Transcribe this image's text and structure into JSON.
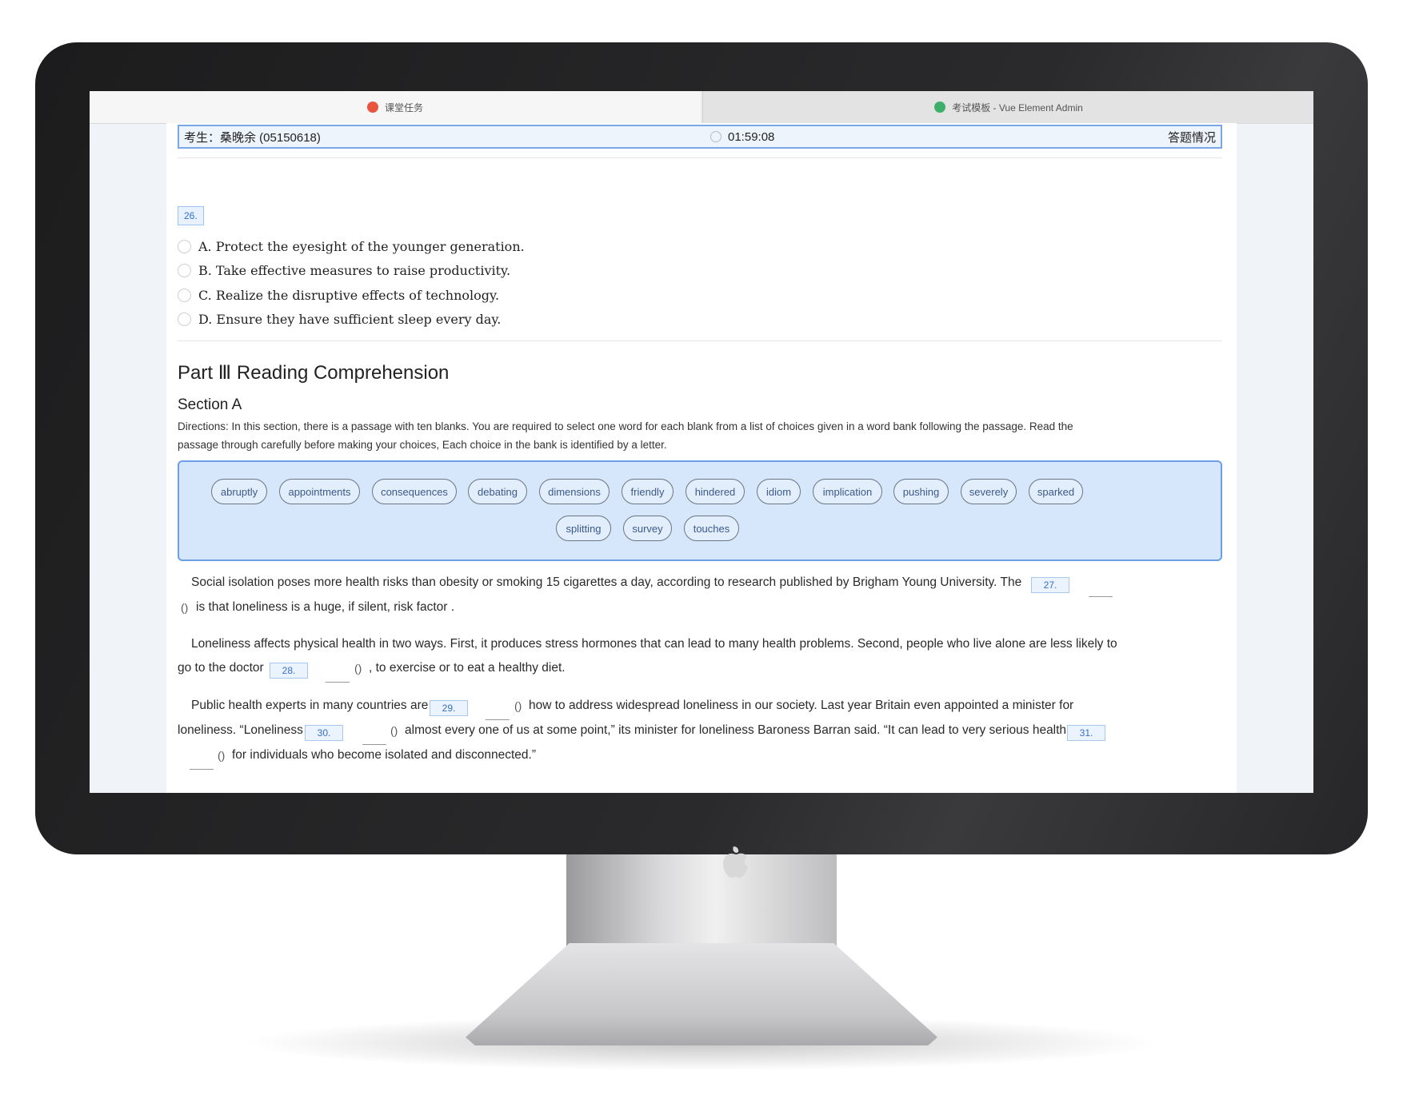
{
  "browser": {
    "tabs": [
      {
        "label": "课堂任务",
        "active": true
      },
      {
        "label": "考试模板 - Vue Element Admin",
        "active": false
      }
    ]
  },
  "exam_header": {
    "student": "考生：桑晚余 (05150618)",
    "timer": "01:59:08",
    "status_link": "答题情况"
  },
  "question26": {
    "number": "26.",
    "options": [
      "A. Protect the eyesight of the younger generation.",
      "B. Take effective measures to raise productivity.",
      "C. Realize the disruptive effects of technology.",
      "D. Ensure they have sufficient sleep every day."
    ]
  },
  "part": {
    "title": "Part Ⅲ Reading Comprehension",
    "section": "Section A",
    "directions_line1": "Directions: In this section, there is a passage with ten blanks. You are required to select one word for each blank from a list of choices given in a word bank following the passage. Read the",
    "directions_line2": "passage through carefully before making your choices, Each choice in the bank is identified by a letter."
  },
  "word_bank": [
    "abruptly",
    "appointments",
    "consequences",
    "debating",
    "dimensions",
    "friendly",
    "hindered",
    "idiom",
    "implication",
    "pushing",
    "severely",
    "sparked",
    "splitting",
    "survey",
    "touches"
  ],
  "passage": {
    "p1_a": "Social isolation poses more health risks than obesity or smoking 15 cigarettes a day,  according to research published by Brigham Young University. The",
    "p1_b": "is that loneliness is a huge, if silent, risk factor .",
    "p2_a": "Loneliness affects physical health in two ways. First, it produces stress hormones that can lead to many health problems. Second, people who live alone are less likely to",
    "p2_b": "go to the doctor",
    "p2_c": ", to exercise or to eat a healthy diet.",
    "p3_a": "Public health experts in many countries are",
    "p3_b": "how to address widespread loneliness in our society. Last year Britain even appointed a minister for",
    "p3_c": "loneliness. “Loneliness",
    "p3_d": "almost every one of us at some point,” its minister for loneliness Baroness Barran said. “It can lead to very serious health",
    "p3_e": "for individuals who become isolated and disconnected.”",
    "blanks": [
      "27.",
      "28.",
      "29.",
      "30.",
      "31."
    ],
    "paren": "()"
  },
  "colors": {
    "accent": "#2f6fd6",
    "bank_bg": "#d6e6fb",
    "blank_bg": "#eaf3fe"
  }
}
